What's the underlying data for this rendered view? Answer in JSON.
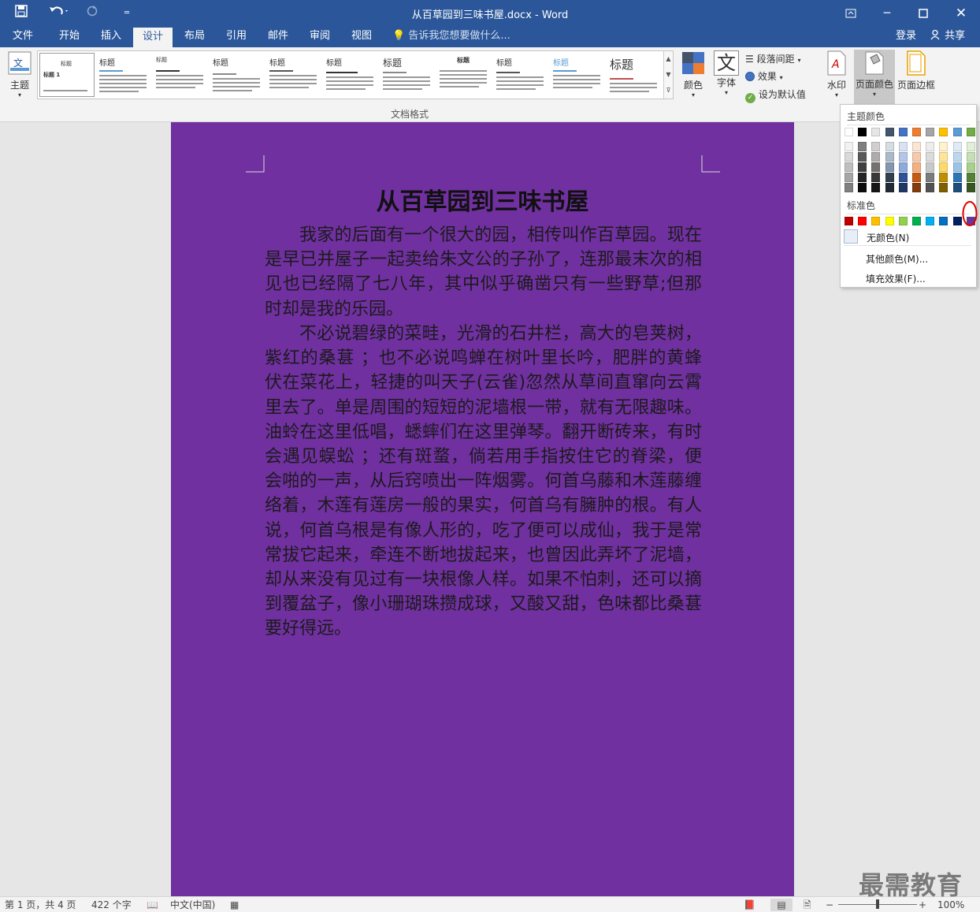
{
  "window": {
    "title": "从百草园到三味书屋.docx - Word"
  },
  "quick_access": {
    "save_icon": "save-icon",
    "undo_icon": "undo-icon",
    "redo_icon": "redo-icon",
    "customize_icon": "customize-qat-icon"
  },
  "tabs": [
    {
      "label": "文件"
    },
    {
      "label": "开始"
    },
    {
      "label": "插入"
    },
    {
      "label": "设计"
    },
    {
      "label": "布局"
    },
    {
      "label": "引用"
    },
    {
      "label": "邮件"
    },
    {
      "label": "审阅"
    },
    {
      "label": "视图"
    }
  ],
  "tell_me": "告诉我您想要做什么...",
  "account": {
    "login": "登录",
    "share": "共享"
  },
  "ribbon": {
    "theme_label": "主题",
    "group_label": "文档格式",
    "style_thumbs": [
      {
        "heading": "标题"
      },
      {
        "heading": "标题"
      },
      {
        "heading": "标题"
      },
      {
        "heading": "标题"
      },
      {
        "heading": "标题"
      },
      {
        "heading": "标题"
      },
      {
        "heading": "标题"
      },
      {
        "heading": "标题"
      },
      {
        "heading": "标题"
      },
      {
        "heading": "标题"
      },
      {
        "heading": "标题"
      }
    ],
    "thumb_sub": "标题 1",
    "colors_label": "颜色",
    "fonts_label": "字体",
    "fonts_glyph": "文",
    "paragraph_spacing": "段落间距",
    "effects": "效果",
    "set_default": "设为默认值",
    "watermark": "水印",
    "page_color": "页面颜色",
    "page_borders": "页面边框"
  },
  "page_color_menu": {
    "theme_colors_header": "主题颜色",
    "standard_colors_header": "标准色",
    "no_color": "无颜色(N)",
    "more_colors": "其他颜色(M)...",
    "fill_effects": "填充效果(F)...",
    "theme_top": [
      "#ffffff",
      "#000000",
      "#e7e6e6",
      "#44546a",
      "#4472c4",
      "#ed7d31",
      "#a5a5a5",
      "#ffc000",
      "#5b9bd5",
      "#70ad47"
    ],
    "theme_shades": [
      [
        "#f2f2f2",
        "#d9d9d9",
        "#bfbfbf",
        "#a6a6a6",
        "#808080"
      ],
      [
        "#7f7f7f",
        "#595959",
        "#404040",
        "#262626",
        "#0d0d0d"
      ],
      [
        "#d0cece",
        "#aeabab",
        "#757171",
        "#3a3838",
        "#171616"
      ],
      [
        "#d6dce4",
        "#acb9ca",
        "#8496b0",
        "#333f4f",
        "#222a35"
      ],
      [
        "#d9e2f3",
        "#b4c6e7",
        "#8eaadb",
        "#2f5496",
        "#1f3864"
      ],
      [
        "#fbe5d5",
        "#f7caac",
        "#f4b083",
        "#c55a11",
        "#833c0b"
      ],
      [
        "#ededed",
        "#dbdbdb",
        "#c9c9c9",
        "#7b7b7b",
        "#525252"
      ],
      [
        "#fff2cc",
        "#ffe599",
        "#ffd965",
        "#bf8f00",
        "#7f6000"
      ],
      [
        "#deebf6",
        "#bdd7ee",
        "#9cc3e5",
        "#2e75b5",
        "#1e4e79"
      ],
      [
        "#e2efd9",
        "#c5e0b3",
        "#a8d08d",
        "#538135",
        "#375623"
      ]
    ],
    "standard": [
      "#c00000",
      "#ff0000",
      "#ffc000",
      "#ffff00",
      "#92d050",
      "#00b050",
      "#00b0f0",
      "#0070c0",
      "#002060",
      "#7030a0"
    ]
  },
  "document": {
    "page_color": "#7030a0",
    "title": "从百草园到三味书屋",
    "paragraphs": [
      "我家的后面有一个很大的园，相传叫作百草园。现在是早已并屋子一起卖给朱文公的子孙了，连那最末次的相见也已经隔了七八年，其中似乎确凿只有一些野草;但那时却是我的乐园。",
      "不必说碧绿的菜畦，光滑的石井栏，高大的皂荚树，紫红的桑葚 ；也不必说鸣蝉在树叶里长吟，肥胖的黄蜂伏在菜花上，轻捷的叫天子(云雀)忽然从草间直窜向云霄里去了。单是周围的短短的泥墙根一带，就有无限趣味。油蛉在这里低唱，蟋蟀们在这里弹琴。翻开断砖来，有时会遇见蜈蚣 ；还有斑蝥，倘若用手指按住它的脊梁，便会啪的一声，从后窍喷出一阵烟雾。何首乌藤和木莲藤缠络着，木莲有莲房一般的果实，何首乌有臃肿的根。有人说，何首乌根是有像人形的，吃了便可以成仙，我于是常常拔它起来，牵连不断地拔起来，也曾因此弄坏了泥墙，却从来没有见过有一块根像人样。如果不怕刺，还可以摘到覆盆子，像小珊瑚珠攒成球，又酸又甜，色味都比桑葚要好得远。"
    ]
  },
  "status": {
    "page": "第 1 页，共 4 页",
    "words": "422 个字",
    "language": "中文(中国)",
    "zoom": "100%",
    "zoom_level": 1.0
  },
  "watermark_text": "最需教育"
}
